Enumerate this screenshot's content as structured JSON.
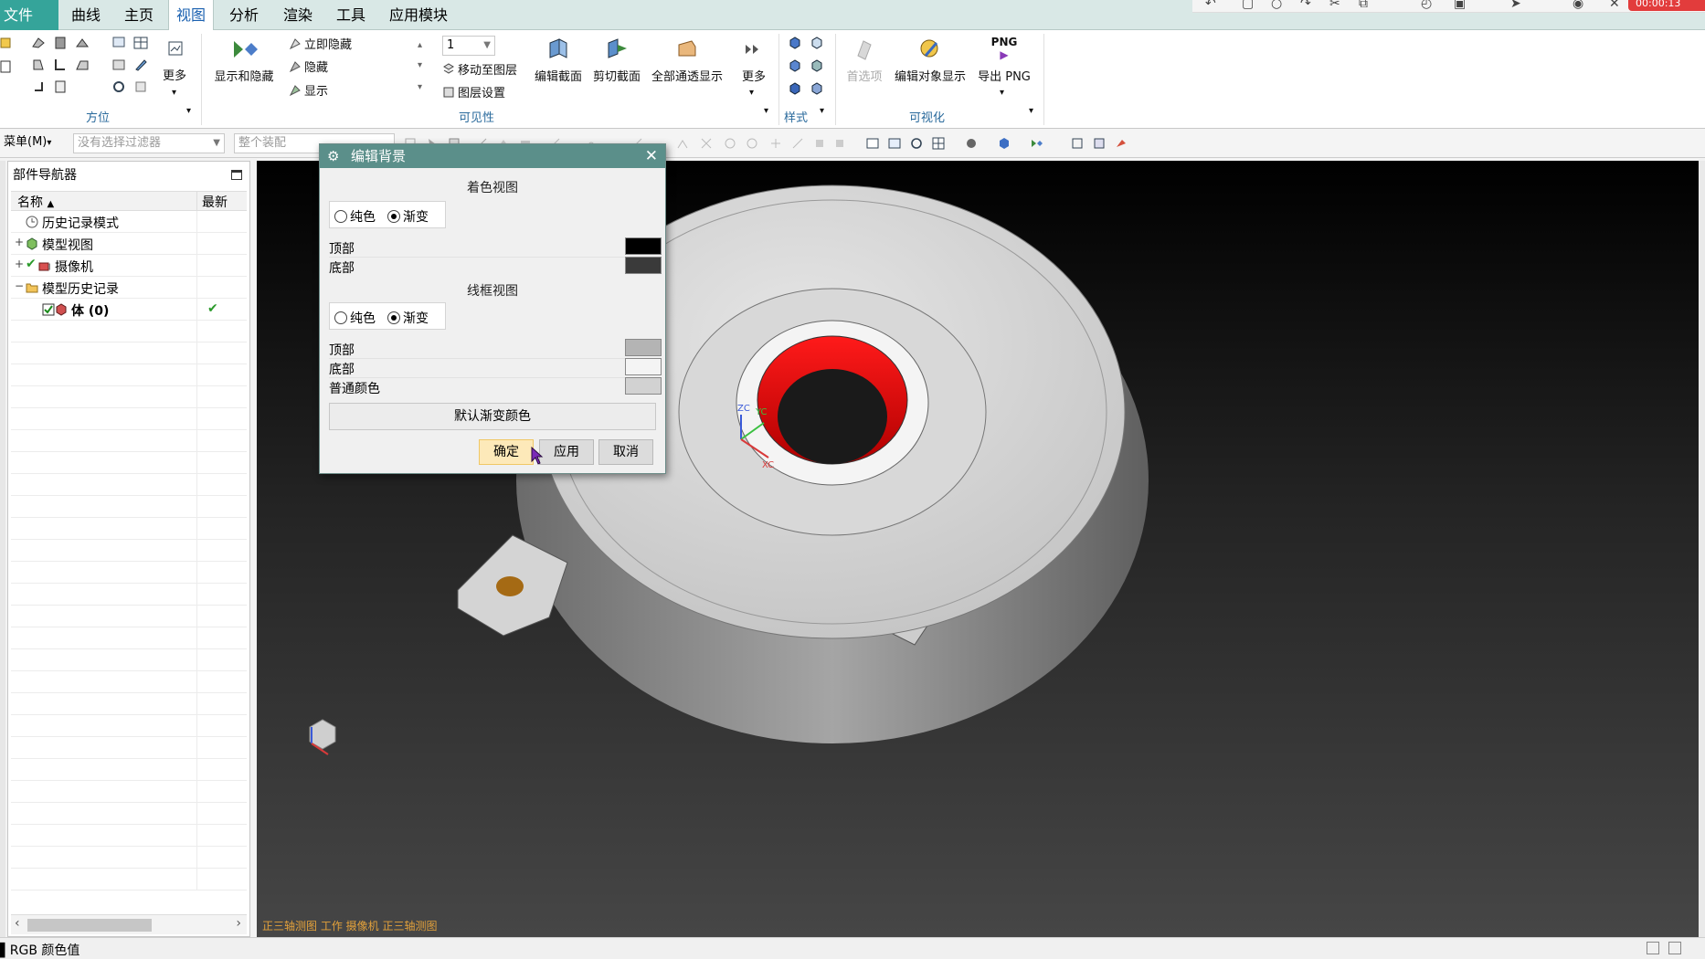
{
  "menubar": {
    "file": "文件(F)",
    "tabs": [
      "曲线",
      "主页",
      "视图",
      "分析",
      "渲染",
      "工具",
      "应用模块"
    ],
    "active_tab": "视图",
    "timer": "00:00:13"
  },
  "ribbon": {
    "groups": {
      "orientation": "方位",
      "visibility": "可见性",
      "style": "样式",
      "visualization": "可视化"
    },
    "more1": "更多",
    "show_hide": "显示和隐藏",
    "instant_hide": "立即隐藏",
    "hide": "隐藏",
    "show": "显示",
    "layer_value": "1",
    "move_to_layer": "移动至图层",
    "layer_settings": "图层设置",
    "edit_section": "编辑截面",
    "clip_section": "剪切截面",
    "all_transparent": "全部通透显示",
    "more2": "更多",
    "preferences": "首选项",
    "edit_obj_display": "编辑对象显示",
    "png_top": "PNG",
    "export_png": "导出 PNG"
  },
  "cmdbar": {
    "menu": "菜单(M)",
    "filter_placeholder": "没有选择过滤器",
    "assembly_placeholder": "整个装配"
  },
  "navigator": {
    "title": "部件导航器",
    "col_name": "名称",
    "col_latest": "最新",
    "items": [
      {
        "label": "历史记录模式"
      },
      {
        "label": "模型视图"
      },
      {
        "label": "摄像机"
      },
      {
        "label": "模型历史记录"
      },
      {
        "label": "体 (0)"
      }
    ]
  },
  "viewport": {
    "status": "正三轴测图 工作 摄像机 正三轴测图",
    "axis_zc": "ZC",
    "axis_yc": "YC",
    "axis_xc": "XC"
  },
  "dialog": {
    "title": "编辑背景",
    "shaded_view": "着色视图",
    "wireframe_view": "线框视图",
    "solid": "纯色",
    "gradient": "渐变",
    "top": "顶部",
    "bottom": "底部",
    "plain_color": "普通颜色",
    "default_gradient": "默认渐变颜色",
    "ok": "确定",
    "apply": "应用",
    "cancel": "取消",
    "colors": {
      "shaded_top": "#000000",
      "shaded_bottom": "#3a3a3a",
      "wire_top": "#b4b4b4",
      "wire_bottom": "#f4f4f4",
      "plain": "#d2d2d2"
    }
  },
  "statusbar": {
    "text": "RGB 颜色值"
  }
}
